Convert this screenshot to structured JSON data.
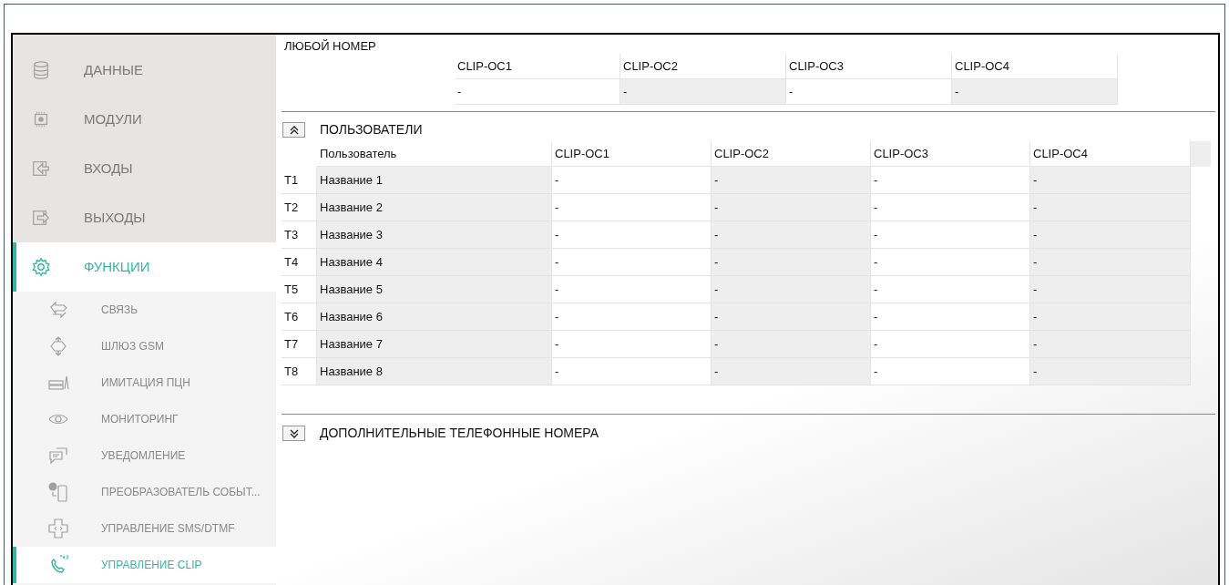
{
  "sidebar": {
    "items": [
      {
        "label": "ДАННЫЕ",
        "selected": false
      },
      {
        "label": "МОДУЛИ",
        "selected": false
      },
      {
        "label": "ВХОДЫ",
        "selected": false
      },
      {
        "label": "ВЫХОДЫ",
        "selected": false
      },
      {
        "label": "ФУНКЦИИ",
        "selected": true,
        "children": [
          {
            "label": "СВЯЗЬ",
            "selected": false
          },
          {
            "label": "ШЛЮЗ GSM",
            "selected": false
          },
          {
            "label": "ИМИТАЦИЯ ПЦН",
            "selected": false
          },
          {
            "label": "МОНИТОРИНГ",
            "selected": false
          },
          {
            "label": "УВЕДОМЛЕНИЕ",
            "selected": false
          },
          {
            "label": "ПРЕОБРАЗОВАТЕЛЬ СОБЫТ...",
            "selected": false
          },
          {
            "label": "УПРАВЛЕНИЕ SMS/DTMF",
            "selected": false
          },
          {
            "label": "УПРАВЛЕНИЕ CLIP",
            "selected": true
          }
        ]
      }
    ]
  },
  "any_number": {
    "title": "ЛЮБОЙ НОМЕР",
    "columns": [
      "CLIP-OC1",
      "CLIP-OC2",
      "CLIP-OC3",
      "CLIP-OC4"
    ],
    "values": [
      "-",
      "-",
      "-",
      "-"
    ]
  },
  "users": {
    "title": "ПОЛЬЗОВАТЕЛИ",
    "expanded": true,
    "columns": [
      "Пользователь",
      "CLIP-OC1",
      "CLIP-OC2",
      "CLIP-OC3",
      "CLIP-OC4"
    ],
    "rows": [
      {
        "index": "T1",
        "name": "Название 1",
        "values": [
          "-",
          "-",
          "-",
          "-"
        ]
      },
      {
        "index": "T2",
        "name": "Название 2",
        "values": [
          "-",
          "-",
          "-",
          "-"
        ]
      },
      {
        "index": "T3",
        "name": "Название 3",
        "values": [
          "-",
          "-",
          "-",
          "-"
        ]
      },
      {
        "index": "T4",
        "name": "Название 4",
        "values": [
          "-",
          "-",
          "-",
          "-"
        ]
      },
      {
        "index": "T5",
        "name": "Название 5",
        "values": [
          "-",
          "-",
          "-",
          "-"
        ]
      },
      {
        "index": "T6",
        "name": "Название 6",
        "values": [
          "-",
          "-",
          "-",
          "-"
        ]
      },
      {
        "index": "T7",
        "name": "Название 7",
        "values": [
          "-",
          "-",
          "-",
          "-"
        ]
      },
      {
        "index": "T8",
        "name": "Название 8",
        "values": [
          "-",
          "-",
          "-",
          "-"
        ]
      }
    ]
  },
  "extra_numbers": {
    "title": "ДОПОЛНИТЕЛЬНЫЕ ТЕЛЕФОННЫЕ НОМЕРА",
    "expanded": false
  }
}
